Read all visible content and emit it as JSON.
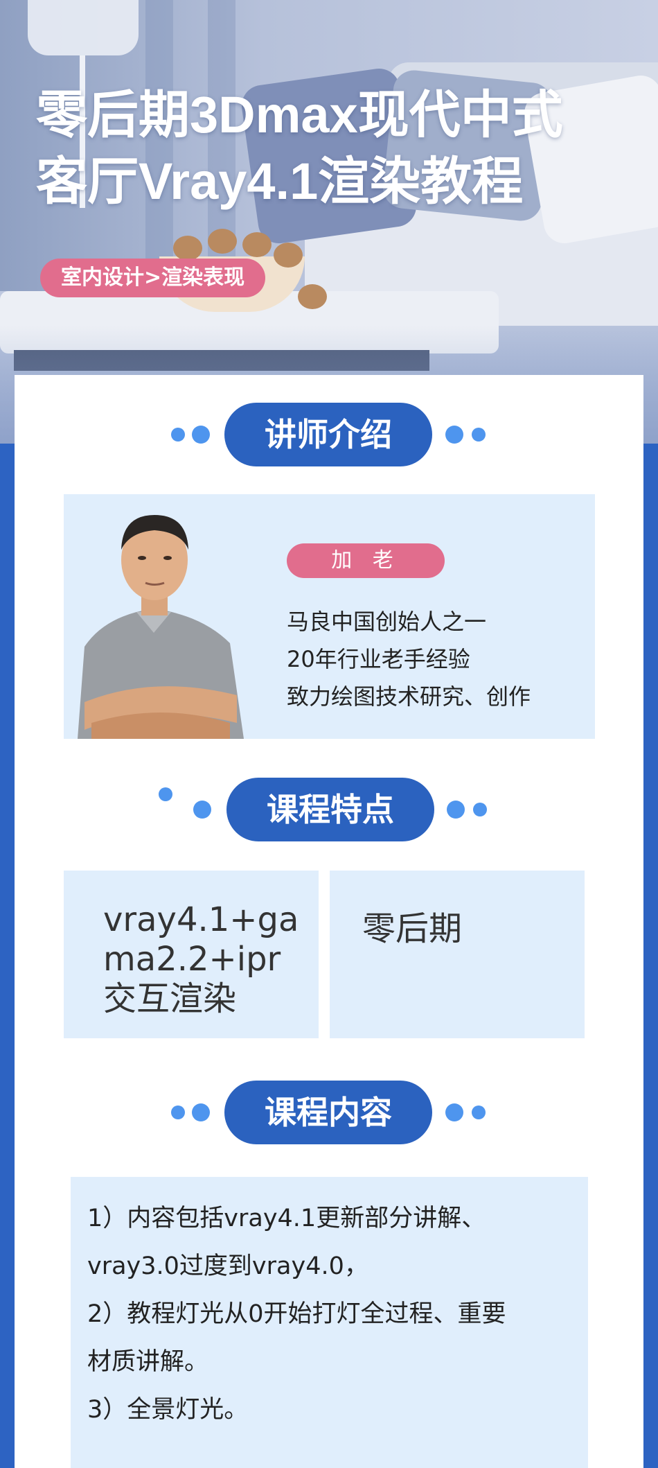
{
  "hero": {
    "title_line1": "零后期3Dmax现代中式",
    "title_line2": "客厅Vray4.1渲染教程",
    "tag": "室内设计>渲染表现"
  },
  "sections": {
    "teacher": "讲师介绍",
    "features": "课程特点",
    "content": "课程内容"
  },
  "teacher": {
    "name": "加 老",
    "bio": [
      "马良中国创始人之一",
      "20年行业老手经验",
      "致力绘图技术研究、创作"
    ]
  },
  "features": {
    "left": [
      "vray4.1+ga",
      "ma2.2+ipr",
      "交互渲染"
    ],
    "right": "零后期"
  },
  "course_content": {
    "lines": [
      "1）内容包括vray4.1更新部分讲解、",
      "vray3.0过度到vray4.0，",
      "2）教程灯光从0开始打灯全过程、重要",
      "材质讲解。",
      "3）全景灯光。"
    ]
  },
  "colors": {
    "brand_blue": "#2b62bf",
    "accent_pink": "#e16d8d",
    "light_panel": "#e0eefc",
    "dot_blue": "#4e95ee"
  }
}
